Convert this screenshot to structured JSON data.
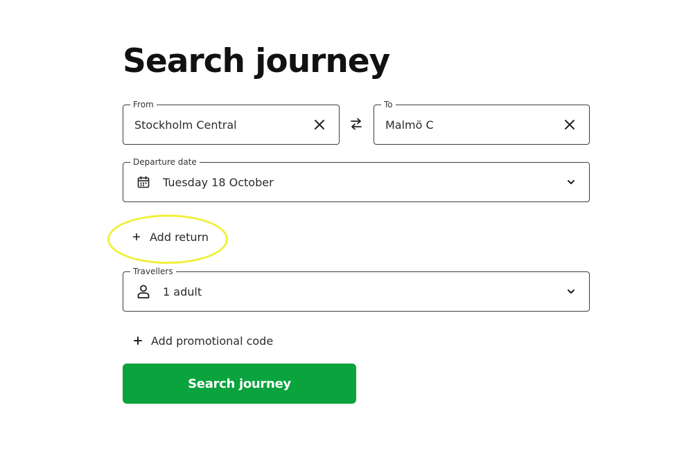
{
  "page": {
    "title": "Search journey"
  },
  "from_field": {
    "label": "From",
    "value": "Stockholm Central",
    "clear_icon": "close-icon"
  },
  "to_field": {
    "label": "To",
    "value": "Malmö C",
    "clear_icon": "close-icon"
  },
  "swap": {
    "icon": "swap-arrows-icon"
  },
  "departure": {
    "label": "Departure date",
    "value": "Tuesday 18 October",
    "icon": "calendar-icon",
    "chevron_icon": "chevron-down-icon"
  },
  "add_return": {
    "label": "Add return",
    "icon": "plus-icon",
    "highlight_color": "#f2ef3a"
  },
  "travellers": {
    "label": "Travellers",
    "value": "1 adult",
    "icon": "person-icon",
    "chevron_icon": "chevron-down-icon"
  },
  "promo": {
    "label": "Add promotional code",
    "icon": "plus-icon"
  },
  "submit": {
    "label": "Search journey",
    "color": "#0aa33e"
  }
}
